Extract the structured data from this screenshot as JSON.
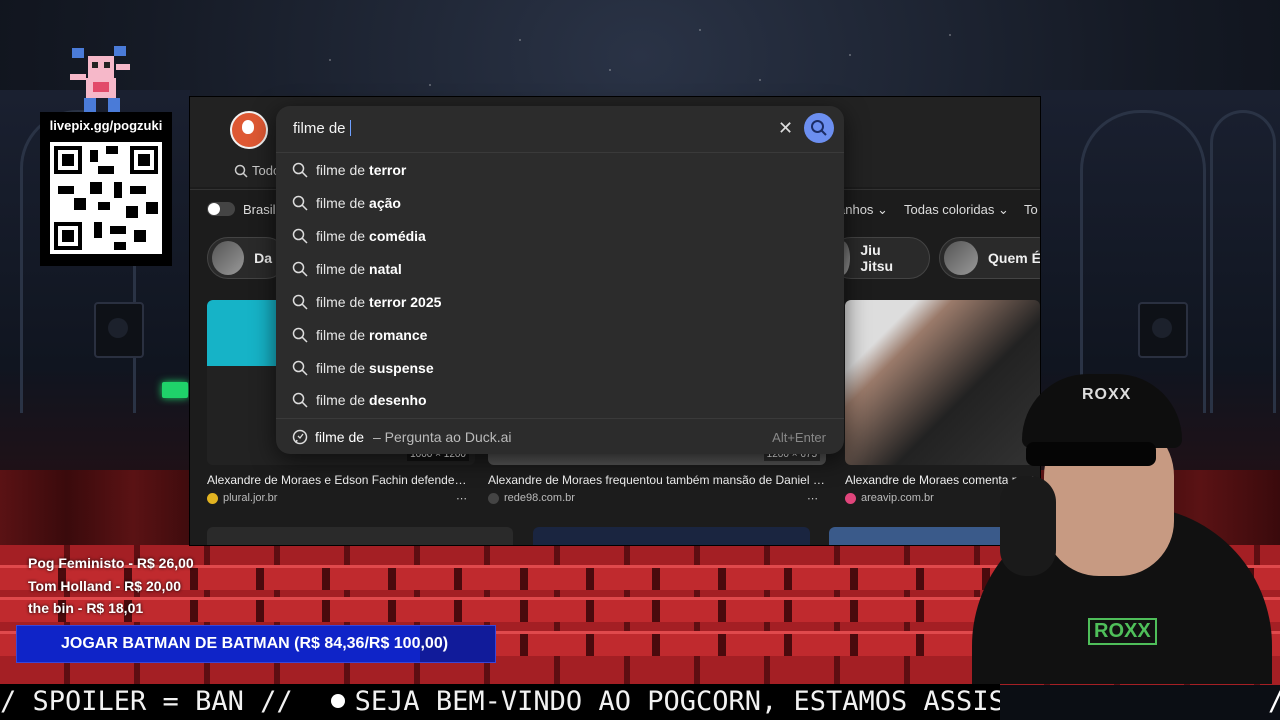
{
  "browser": {
    "tab_all_label": "Todo",
    "region_label": "Brasil",
    "filters": [
      "anhos",
      "Todas coloridas",
      "To"
    ],
    "chips": [
      {
        "label": "Da"
      },
      {
        "label": "Jiu Jitsu"
      },
      {
        "label": "Quem É"
      }
    ],
    "results": [
      {
        "title": "Alexandre de Moraes e Edson Fachin defendem ...",
        "source": "plural.jor.br",
        "dims": "1000 × 1200"
      },
      {
        "title": "Alexandre de Moraes frequentou também mansão de Daniel V...",
        "source": "rede98.com.br",
        "dims": "1200 × 675"
      },
      {
        "title": "Alexandre de Moraes comenta post",
        "source": "areavip.com.br",
        "dims": ""
      }
    ]
  },
  "search": {
    "query": "filme de",
    "clear_icon": "close-icon",
    "submit_icon": "search-icon",
    "suggestions": [
      {
        "prefix": "filme de",
        "completion": "terror"
      },
      {
        "prefix": "filme de",
        "completion": "ação"
      },
      {
        "prefix": "filme de",
        "completion": "comédia"
      },
      {
        "prefix": "filme de",
        "completion": "natal"
      },
      {
        "prefix": "filme de",
        "completion": "terror 2025"
      },
      {
        "prefix": "filme de",
        "completion": "romance"
      },
      {
        "prefix": "filme de",
        "completion": "suspense"
      },
      {
        "prefix": "filme de",
        "completion": "desenho"
      }
    ],
    "duck_ai": {
      "query": "filme de",
      "hint": "– Pergunta ao Duck.ai",
      "shortcut": "Alt+Enter"
    }
  },
  "overlay": {
    "qr_url": "livepix.gg/pogzuki",
    "donors": [
      "Pog Feministo - R$ 26,00",
      "Tom Holland - R$ 20,00",
      "the bin - R$ 18,01"
    ],
    "goal_text": "JOGAR BATMAN DE BATMAN (R$ 84,36/R$ 100,00)",
    "goal_progress": 0.8436,
    "ticker_left": "/ SPOILER = BAN //",
    "ticker_right": "SEJA BEM-VINDO AO POGCORN, ESTAMOS ASSISTIND",
    "ticker_end": "/",
    "cap_logo": "ROXX",
    "shirt_logo": "ROXX"
  },
  "colors": {
    "search_accent": "#6c8ff0",
    "goal_bar": "#0f24c8",
    "duckduckgo": "#de5833"
  }
}
